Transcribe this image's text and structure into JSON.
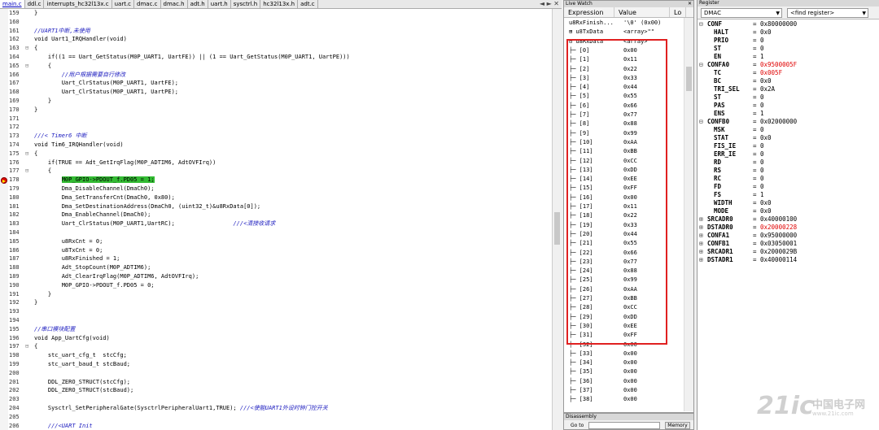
{
  "editor": {
    "tabs": [
      "main.c",
      "ddl.c",
      "interrupts_hc32l13x.c",
      "uart.c",
      "dmac.c",
      "dmac.h",
      "adt.h",
      "uart.h",
      "sysctrl.h",
      "hc32l13x.h",
      "adt.c"
    ],
    "active_tab": 0,
    "tab_controls": "◄ ► ✕",
    "lines": [
      {
        "n": "159",
        "f": "",
        "t": "}"
      },
      {
        "n": "160",
        "f": "",
        "t": ""
      },
      {
        "n": "161",
        "f": "",
        "t": "//UART1中断,未使用",
        "c": true
      },
      {
        "n": "162",
        "f": "",
        "t": "void Uart1_IRQHandler(void)"
      },
      {
        "n": "163",
        "f": "⊟",
        "t": "{"
      },
      {
        "n": "164",
        "f": "",
        "t": "    if((1 == Uart_GetStatus(M0P_UART1, UartFE)) || (1 == Uart_GetStatus(M0P_UART1, UartPE)))"
      },
      {
        "n": "165",
        "f": "⊟",
        "t": "    {"
      },
      {
        "n": "166",
        "f": "",
        "t": "        //用户根据需要自行修改",
        "c": true
      },
      {
        "n": "167",
        "f": "",
        "t": "        Uart_ClrStatus(M0P_UART1, UartFE);"
      },
      {
        "n": "168",
        "f": "",
        "t": "        Uart_ClrStatus(M0P_UART1, UartPE);"
      },
      {
        "n": "169",
        "f": "",
        "t": "    }"
      },
      {
        "n": "170",
        "f": "",
        "t": "}"
      },
      {
        "n": "171",
        "f": "",
        "t": ""
      },
      {
        "n": "172",
        "f": "",
        "t": ""
      },
      {
        "n": "173",
        "f": "",
        "t": "///< Timer6 中断",
        "c": true
      },
      {
        "n": "174",
        "f": "",
        "t": "void Tim6_IRQHandler(void)"
      },
      {
        "n": "175",
        "f": "⊟",
        "t": "{"
      },
      {
        "n": "176",
        "f": "",
        "t": "    if(TRUE == Adt_GetIrqFlag(M0P_ADTIM6, AdtOVFIrq))"
      },
      {
        "n": "177",
        "f": "⊟",
        "t": "    {"
      },
      {
        "n": "178",
        "f": "",
        "t": "M0P_GPIO->PDOUT_f.PD05 = 1;",
        "hl": true,
        "indent": "        "
      },
      {
        "n": "179",
        "f": "",
        "t": "        Dma_DisableChannel(DmaCh0);"
      },
      {
        "n": "180",
        "f": "",
        "t": "        Dma_SetTransferCnt(DmaCh0, 0x80);"
      },
      {
        "n": "181",
        "f": "",
        "t": "        Dma_SetDestinationAddress(DmaCh0, (uint32_t)&u8RxData[0]);"
      },
      {
        "n": "182",
        "f": "",
        "t": "        Dma_EnableChannel(DmaCh0);"
      },
      {
        "n": "183",
        "f": "",
        "t": "        Uart_ClrStatus(M0P_UART1,UartRC);",
        "cmt2": "                 ///<清接收请求"
      },
      {
        "n": "184",
        "f": "",
        "t": ""
      },
      {
        "n": "185",
        "f": "",
        "t": "        u8RxCnt = 0;"
      },
      {
        "n": "186",
        "f": "",
        "t": "        u8TxCnt = 0;"
      },
      {
        "n": "187",
        "f": "",
        "t": "        u8RxFinished = 1;"
      },
      {
        "n": "188",
        "f": "",
        "t": "        Adt_StopCount(M0P_ADTIM6);"
      },
      {
        "n": "189",
        "f": "",
        "t": "        Adt_ClearIrqFlag(M0P_ADTIM6, AdtOVFIrq);"
      },
      {
        "n": "190",
        "f": "",
        "t": "        M0P_GPIO->PDOUT_f.PD05 = 0;"
      },
      {
        "n": "191",
        "f": "",
        "t": "    }"
      },
      {
        "n": "192",
        "f": "",
        "t": "}"
      },
      {
        "n": "193",
        "f": "",
        "t": ""
      },
      {
        "n": "194",
        "f": "",
        "t": ""
      },
      {
        "n": "195",
        "f": "",
        "t": "//串口模块配置",
        "c": true
      },
      {
        "n": "196",
        "f": "",
        "t": "void App_UartCfg(void)"
      },
      {
        "n": "197",
        "f": "⊟",
        "t": "{"
      },
      {
        "n": "198",
        "f": "",
        "t": "    stc_uart_cfg_t  stcCfg;"
      },
      {
        "n": "199",
        "f": "",
        "t": "    stc_uart_baud_t stcBaud;"
      },
      {
        "n": "200",
        "f": "",
        "t": ""
      },
      {
        "n": "201",
        "f": "",
        "t": "    DDL_ZERO_STRUCT(stcCfg);"
      },
      {
        "n": "202",
        "f": "",
        "t": "    DDL_ZERO_STRUCT(stcBaud);"
      },
      {
        "n": "203",
        "f": "",
        "t": ""
      },
      {
        "n": "204",
        "f": "",
        "t": "    Sysctrl_SetPeripheralGate(SysctrlPeripheralUart1,TRUE);",
        "cmt2": " ///<使能UART1外设时钟门控开关"
      },
      {
        "n": "205",
        "f": "",
        "t": ""
      },
      {
        "n": "206",
        "f": "",
        "t": "    ///<UART Init",
        "c": true
      }
    ]
  },
  "watch": {
    "title": "Live Watch",
    "close": "✕",
    "col_expression": "Expression",
    "col_value": "Value",
    "col_loc": "Lo",
    "rows": [
      {
        "e": "u8RxFinish...",
        "v": "'\\0' (0x00)"
      },
      {
        "e": "⊞ u8TxData",
        "v": "<array>\"\""
      },
      {
        "e": "⊟ u8RxData",
        "v": "<array>\"\""
      },
      {
        "e": "├─ [0]",
        "v": "0x00"
      },
      {
        "e": "├─ [1]",
        "v": "0x11"
      },
      {
        "e": "├─ [2]",
        "v": "0x22"
      },
      {
        "e": "├─ [3]",
        "v": "0x33"
      },
      {
        "e": "├─ [4]",
        "v": "0x44"
      },
      {
        "e": "├─ [5]",
        "v": "0x55"
      },
      {
        "e": "├─ [6]",
        "v": "0x66"
      },
      {
        "e": "├─ [7]",
        "v": "0x77"
      },
      {
        "e": "├─ [8]",
        "v": "0x88"
      },
      {
        "e": "├─ [9]",
        "v": "0x99"
      },
      {
        "e": "├─ [10]",
        "v": "0xAA"
      },
      {
        "e": "├─ [11]",
        "v": "0xBB"
      },
      {
        "e": "├─ [12]",
        "v": "0xCC"
      },
      {
        "e": "├─ [13]",
        "v": "0xDD"
      },
      {
        "e": "├─ [14]",
        "v": "0xEE"
      },
      {
        "e": "├─ [15]",
        "v": "0xFF"
      },
      {
        "e": "├─ [16]",
        "v": "0x00"
      },
      {
        "e": "├─ [17]",
        "v": "0x11"
      },
      {
        "e": "├─ [18]",
        "v": "0x22"
      },
      {
        "e": "├─ [19]",
        "v": "0x33"
      },
      {
        "e": "├─ [20]",
        "v": "0x44"
      },
      {
        "e": "├─ [21]",
        "v": "0x55"
      },
      {
        "e": "├─ [22]",
        "v": "0x66"
      },
      {
        "e": "├─ [23]",
        "v": "0x77"
      },
      {
        "e": "├─ [24]",
        "v": "0x88"
      },
      {
        "e": "├─ [25]",
        "v": "0x99"
      },
      {
        "e": "├─ [26]",
        "v": "0xAA"
      },
      {
        "e": "├─ [27]",
        "v": "0xBB"
      },
      {
        "e": "├─ [28]",
        "v": "0xCC"
      },
      {
        "e": "├─ [29]",
        "v": "0xDD"
      },
      {
        "e": "├─ [30]",
        "v": "0xEE"
      },
      {
        "e": "├─ [31]",
        "v": "0xFF"
      },
      {
        "e": "├─ [32]",
        "v": "0x00"
      },
      {
        "e": "├─ [33]",
        "v": "0x00"
      },
      {
        "e": "├─ [34]",
        "v": "0x00"
      },
      {
        "e": "├─ [35]",
        "v": "0x00"
      },
      {
        "e": "├─ [36]",
        "v": "0x00"
      },
      {
        "e": "├─ [37]",
        "v": "0x00"
      },
      {
        "e": "├─ [38]",
        "v": "0x00"
      }
    ]
  },
  "disassembly": {
    "title": "Disassembly",
    "goto_label": "Go to",
    "memory_button": "Memory"
  },
  "register": {
    "title": "Register",
    "group": "DMAC",
    "find_placeholder": "<find register>",
    "rows": [
      {
        "b": "⊟",
        "n": "CONF",
        "v": "0x80000000",
        "sub": false,
        "red": false
      },
      {
        "b": "",
        "n": "HALT",
        "v": "0x0",
        "sub": true,
        "red": false
      },
      {
        "b": "",
        "n": "PRIO",
        "v": "0",
        "sub": true,
        "red": false
      },
      {
        "b": "",
        "n": "ST",
        "v": "0",
        "sub": true,
        "red": false
      },
      {
        "b": "",
        "n": "EN",
        "v": "1",
        "sub": true,
        "red": false
      },
      {
        "b": "⊟",
        "n": "CONFA0",
        "v": "0x9500005F",
        "sub": false,
        "red": true
      },
      {
        "b": "",
        "n": "TC",
        "v": "0x005F",
        "sub": true,
        "red": true
      },
      {
        "b": "",
        "n": "BC",
        "v": "0x0",
        "sub": true,
        "red": false
      },
      {
        "b": "",
        "n": "TRI_SEL",
        "v": "0x2A",
        "sub": true,
        "red": false
      },
      {
        "b": "",
        "n": "ST",
        "v": "0",
        "sub": true,
        "red": false
      },
      {
        "b": "",
        "n": "PAS",
        "v": "0",
        "sub": true,
        "red": false
      },
      {
        "b": "",
        "n": "ENS",
        "v": "1",
        "sub": true,
        "red": false
      },
      {
        "b": "⊟",
        "n": "CONFB0",
        "v": "0x02000000",
        "sub": false,
        "red": false
      },
      {
        "b": "",
        "n": "MSK",
        "v": "0",
        "sub": true,
        "red": false
      },
      {
        "b": "",
        "n": "STAT",
        "v": "0x0",
        "sub": true,
        "red": false
      },
      {
        "b": "",
        "n": "FIS_IE",
        "v": "0",
        "sub": true,
        "red": false
      },
      {
        "b": "",
        "n": "ERR_IE",
        "v": "0",
        "sub": true,
        "red": false
      },
      {
        "b": "",
        "n": "RD",
        "v": "0",
        "sub": true,
        "red": false
      },
      {
        "b": "",
        "n": "RS",
        "v": "0",
        "sub": true,
        "red": false
      },
      {
        "b": "",
        "n": "RC",
        "v": "0",
        "sub": true,
        "red": false
      },
      {
        "b": "",
        "n": "FD",
        "v": "0",
        "sub": true,
        "red": false
      },
      {
        "b": "",
        "n": "FS",
        "v": "1",
        "sub": true,
        "red": false
      },
      {
        "b": "",
        "n": "WIDTH",
        "v": "0x0",
        "sub": true,
        "red": false
      },
      {
        "b": "",
        "n": "MODE",
        "v": "0x0",
        "sub": true,
        "red": false
      },
      {
        "b": "⊞",
        "n": "SRCADR0",
        "v": "0x40000100",
        "sub": false,
        "red": false
      },
      {
        "b": "⊞",
        "n": "DSTADR0",
        "v": "0x20000228",
        "sub": false,
        "red": true
      },
      {
        "b": "⊞",
        "n": "CONFA1",
        "v": "0x95000000",
        "sub": false,
        "red": false
      },
      {
        "b": "⊞",
        "n": "CONFB1",
        "v": "0x03050001",
        "sub": false,
        "red": false
      },
      {
        "b": "⊞",
        "n": "SRCADR1",
        "v": "0x2000029B",
        "sub": false,
        "red": false
      },
      {
        "b": "⊞",
        "n": "DSTADR1",
        "v": "0x40000114",
        "sub": false,
        "red": false
      }
    ]
  },
  "watermark": {
    "logo": "21ic",
    "cn": "中国电子网",
    "url": "www.21ic.com"
  },
  "colors": {
    "highlight": "#33bb33",
    "changed": "#e00000",
    "comment": "#2020c0"
  }
}
